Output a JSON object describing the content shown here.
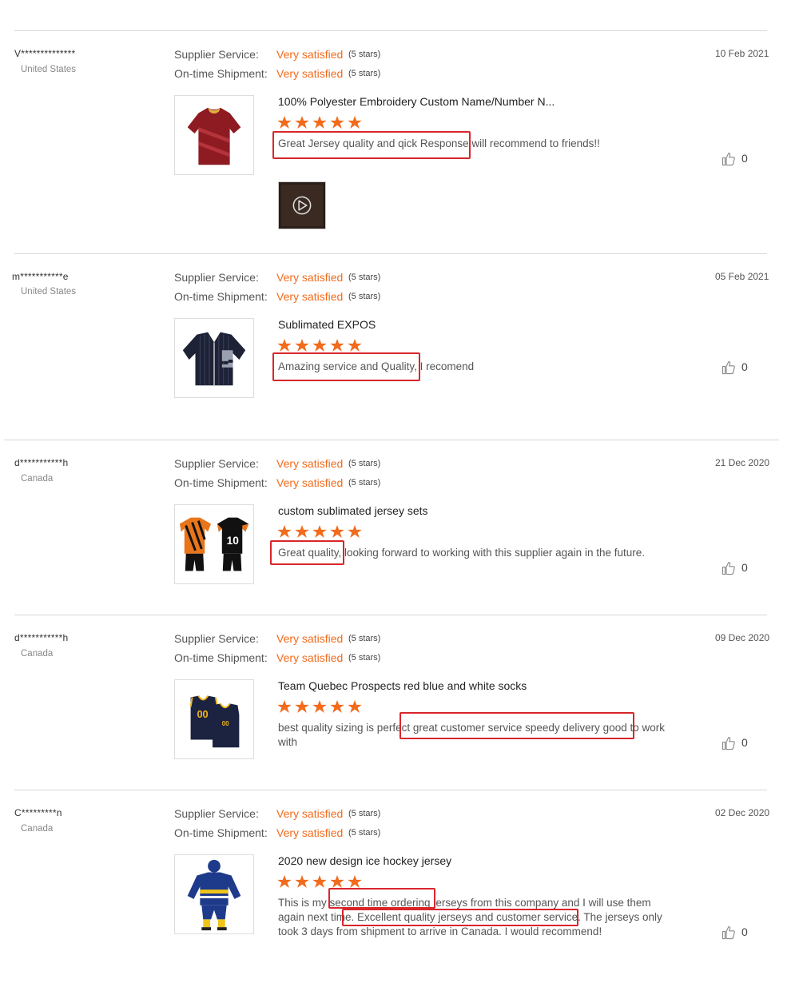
{
  "labels": {
    "supplier_service": "Supplier Service:",
    "ontime_shipment": "On-time Shipment:"
  },
  "reviews": [
    {
      "user": "V**************",
      "country": "United States",
      "supplier_value": "Very satisfied",
      "supplier_stars": "(5 stars)",
      "shipment_value": "Very satisfied",
      "shipment_stars": "(5 stars)",
      "date": "10 Feb 2021",
      "product_title": "100% Polyester Embroidery Custom Name/Number N...",
      "rating": 5,
      "comment": "Great Jersey quality and qick Response will recommend to friends!!",
      "likes": "0",
      "has_video": true
    },
    {
      "user": "m***********e",
      "country": "United States",
      "supplier_value": "Very satisfied",
      "supplier_stars": "(5 stars)",
      "shipment_value": "Very satisfied",
      "shipment_stars": "(5 stars)",
      "date": "05 Feb 2021",
      "product_title": "Sublimated EXPOS",
      "rating": 5,
      "comment": "Amazing service and Quality, I recomend",
      "likes": "0",
      "has_video": false
    },
    {
      "user": "d***********h",
      "country": "Canada",
      "supplier_value": "Very satisfied",
      "supplier_stars": "(5 stars)",
      "shipment_value": "Very satisfied",
      "shipment_stars": "(5 stars)",
      "date": "21 Dec 2020",
      "product_title": "custom sublimated jersey sets",
      "rating": 5,
      "comment": "Great quality, looking forward to working with this supplier again in the future.",
      "likes": "0",
      "has_video": false
    },
    {
      "user": "d***********h",
      "country": "Canada",
      "supplier_value": "Very satisfied",
      "supplier_stars": "(5 stars)",
      "shipment_value": "Very satisfied",
      "shipment_stars": "(5 stars)",
      "date": "09 Dec 2020",
      "product_title": "Team Quebec Prospects red blue and white socks",
      "rating": 5,
      "comment": "best quality sizing is perfect great customer service speedy delivery good to work with",
      "likes": "0",
      "has_video": false
    },
    {
      "user": "C*********n",
      "country": "Canada",
      "supplier_value": "Very satisfied",
      "supplier_stars": "(5 stars)",
      "shipment_value": "Very satisfied",
      "shipment_stars": "(5 stars)",
      "date": "02 Dec 2020",
      "product_title": "2020 new design ice hockey jersey",
      "rating": 5,
      "comment": "This is my second time ordering jerseys from this company and I will use them again next time. Excellent quality jerseys and customer service. The jerseys only took 3 days from shipment to arrive in Canada. I would recommend!",
      "likes": "0",
      "has_video": false
    }
  ],
  "colors": {
    "accent": "#f26b1d",
    "highlight": "#d8262b",
    "separator": "#d8d8d8"
  },
  "icons": {
    "rating": "star-icon",
    "like": "thumbs-up-icon",
    "video": "play-icon"
  }
}
